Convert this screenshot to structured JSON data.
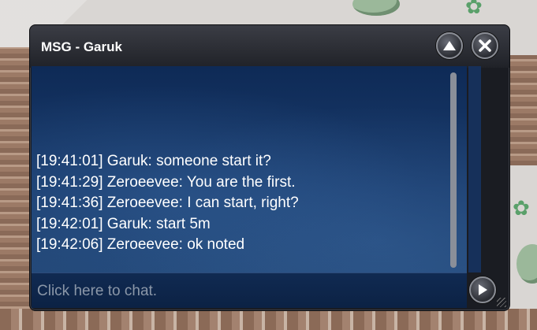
{
  "window": {
    "title": "MSG - Garuk"
  },
  "chat": {
    "messages": [
      "[19:41:01] Garuk: someone start it?",
      "[19:41:29] Zeroeevee: You are the first.",
      "[19:41:36] Zeroeevee: I can start, right?",
      "[19:42:01] Garuk: start 5m",
      "[19:42:06] Zeroeevee: ok noted"
    ],
    "input_placeholder": "Click here to chat."
  },
  "icons": {
    "minimize": "chevron-up-icon",
    "close": "close-icon",
    "send": "play-icon"
  },
  "colors": {
    "chat_background": "#1b3d6e",
    "title_bar": "#2a2c33",
    "text": "#ffffff",
    "placeholder": "#8b97a8"
  }
}
